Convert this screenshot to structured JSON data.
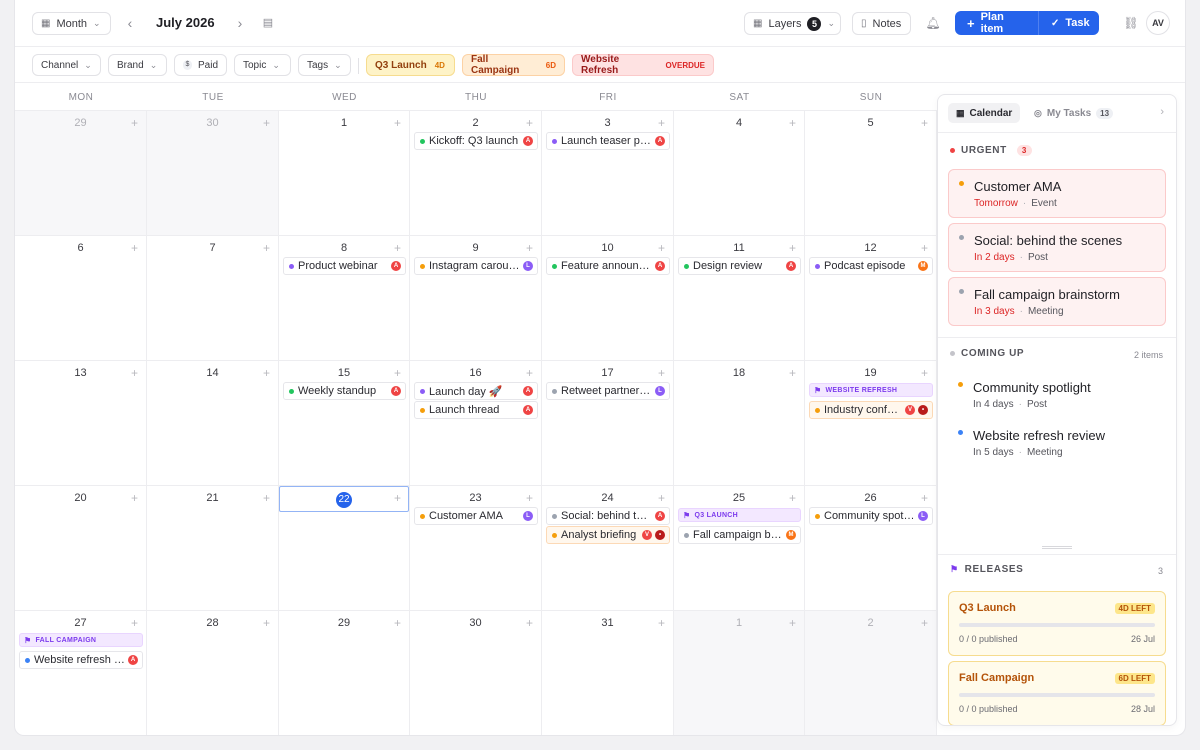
{
  "toolbar": {
    "view_label": "Month",
    "month_title": "July 2026",
    "layers_label": "Layers",
    "layers_count": "5",
    "notes_label": "Notes",
    "plan_item_label": "Plan item",
    "task_label": "Task",
    "avatar_initials": "AV"
  },
  "filters": {
    "channel": "Channel",
    "brand": "Brand",
    "paid": "Paid",
    "paid_symbol": "$",
    "topic": "Topic",
    "tags": "Tags",
    "pills": [
      {
        "label": "Q3 Launch",
        "tag": "4D",
        "bg": "#fef3c7",
        "border": "#f6dc8f",
        "color": "#92400e",
        "tag_color": "#d97706"
      },
      {
        "label": "Fall Campaign",
        "tag": "6D",
        "bg": "#ffedd5",
        "border": "#fcd2a5",
        "color": "#9a3412",
        "tag_color": "#ea580c"
      },
      {
        "label": "Website Refresh",
        "tag": "OVERDUE",
        "bg": "#fee2e2",
        "border": "#fbcaca",
        "color": "#991b1b",
        "tag_color": "#dc2626"
      }
    ]
  },
  "weekdays": [
    "MON",
    "TUE",
    "WED",
    "THU",
    "FRI",
    "SAT",
    "SUN"
  ],
  "weeks": [
    [
      {
        "d": "29",
        "muted": true
      },
      {
        "d": "30",
        "muted": true
      },
      {
        "d": "1"
      },
      {
        "d": "2"
      },
      {
        "d": "3"
      },
      {
        "d": "4"
      },
      {
        "d": "5"
      }
    ],
    [
      {
        "d": "6"
      },
      {
        "d": "7"
      },
      {
        "d": "8"
      },
      {
        "d": "9"
      },
      {
        "d": "10"
      },
      {
        "d": "11"
      },
      {
        "d": "12"
      }
    ],
    [
      {
        "d": "13"
      },
      {
        "d": "14"
      },
      {
        "d": "15"
      },
      {
        "d": "16"
      },
      {
        "d": "17"
      },
      {
        "d": "18"
      },
      {
        "d": "19"
      }
    ],
    [
      {
        "d": "20"
      },
      {
        "d": "21"
      },
      {
        "d": "22",
        "today": true
      },
      {
        "d": "23"
      },
      {
        "d": "24"
      },
      {
        "d": "25"
      },
      {
        "d": "26"
      }
    ],
    [
      {
        "d": "27"
      },
      {
        "d": "28"
      },
      {
        "d": "29"
      },
      {
        "d": "30"
      },
      {
        "d": "31"
      },
      {
        "d": "1",
        "muted": true
      },
      {
        "d": "2",
        "muted": true
      }
    ]
  ],
  "colors": {
    "green": "#22c55e",
    "purple": "#8b5cf6",
    "orange": "#f59e0b",
    "gray": "#9ca3af",
    "blue": "#3b82f6",
    "badge_red": "#ef4444",
    "badge_purple": "#8b5cf6",
    "badge_orange": "#f97316",
    "badge_dark": "#b91c1c"
  },
  "events": [
    {
      "week": 0,
      "day": 3,
      "slot": 0,
      "title": "Kickoff: Q3 launch",
      "dot": "#22c55e",
      "badges": [
        {
          "t": "A",
          "c": "#ef4444"
        }
      ]
    },
    {
      "week": 0,
      "day": 4,
      "slot": 0,
      "title": "Launch teaser post",
      "dot": "#8b5cf6",
      "badges": [
        {
          "t": "A",
          "c": "#ef4444"
        }
      ]
    },
    {
      "week": 1,
      "day": 2,
      "slot": 0,
      "title": "Product webinar",
      "dot": "#8b5cf6",
      "badges": [
        {
          "t": "A",
          "c": "#ef4444"
        }
      ]
    },
    {
      "week": 1,
      "day": 3,
      "slot": 0,
      "title": "Instagram carousel",
      "dot": "#f59e0b",
      "badges": [
        {
          "t": "L",
          "c": "#8b5cf6"
        }
      ]
    },
    {
      "week": 1,
      "day": 4,
      "slot": 0,
      "title": "Feature announcement",
      "dot": "#22c55e",
      "badges": [
        {
          "t": "A",
          "c": "#ef4444"
        }
      ]
    },
    {
      "week": 1,
      "day": 5,
      "slot": 0,
      "title": "Design review",
      "dot": "#22c55e",
      "badges": [
        {
          "t": "A",
          "c": "#ef4444"
        }
      ]
    },
    {
      "week": 1,
      "day": 6,
      "slot": 0,
      "title": "Podcast episode",
      "dot": "#8b5cf6",
      "badges": [
        {
          "t": "M",
          "c": "#f97316"
        }
      ]
    },
    {
      "week": 2,
      "day": 2,
      "slot": 0,
      "title": "Weekly standup",
      "dot": "#22c55e",
      "badges": [
        {
          "t": "A",
          "c": "#ef4444"
        }
      ]
    },
    {
      "week": 2,
      "day": 3,
      "slot": 0,
      "title": "Launch day 🚀",
      "dot": "#8b5cf6",
      "badges": [
        {
          "t": "A",
          "c": "#ef4444"
        }
      ]
    },
    {
      "week": 2,
      "day": 3,
      "slot": 1,
      "title": "Launch thread",
      "dot": "#f59e0b",
      "badges": [
        {
          "t": "A",
          "c": "#ef4444"
        }
      ]
    },
    {
      "week": 2,
      "day": 4,
      "slot": 0,
      "title": "Retweet partner post",
      "dot": "#9ca3af",
      "badges": [
        {
          "t": "L",
          "c": "#8b5cf6"
        }
      ]
    },
    {
      "week": 2,
      "day": 6,
      "slot": 1,
      "title": "Industry conference",
      "dot": "#f59e0b",
      "badges": [
        {
          "t": "V",
          "c": "#ef4444"
        },
        {
          "t": "•",
          "c": "#b91c1c"
        }
      ],
      "warn": true
    },
    {
      "week": 3,
      "day": 3,
      "slot": 0,
      "title": "Customer AMA",
      "dot": "#f59e0b",
      "badges": [
        {
          "t": "L",
          "c": "#8b5cf6"
        }
      ]
    },
    {
      "week": 3,
      "day": 4,
      "slot": 0,
      "title": "Social: behind the scenes",
      "dot": "#9ca3af",
      "badges": [
        {
          "t": "A",
          "c": "#ef4444"
        }
      ]
    },
    {
      "week": 3,
      "day": 4,
      "slot": 1,
      "title": "Analyst briefing",
      "dot": "#f59e0b",
      "badges": [
        {
          "t": "V",
          "c": "#ef4444"
        },
        {
          "t": "•",
          "c": "#b91c1c"
        }
      ],
      "warn": true
    },
    {
      "week": 3,
      "day": 5,
      "slot": 1,
      "title": "Fall campaign brainstorm",
      "dot": "#9ca3af",
      "badges": [
        {
          "t": "M",
          "c": "#f97316"
        }
      ]
    },
    {
      "week": 3,
      "day": 6,
      "slot": 0,
      "title": "Community spotlight",
      "dot": "#f59e0b",
      "badges": [
        {
          "t": "L",
          "c": "#8b5cf6"
        }
      ]
    },
    {
      "week": 4,
      "day": 0,
      "slot": 1,
      "title": "Website refresh review",
      "dot": "#3b82f6",
      "badges": [
        {
          "t": "A",
          "c": "#ef4444"
        }
      ]
    }
  ],
  "banners": [
    {
      "week": 2,
      "day": 6,
      "label": "WEBSITE REFRESH"
    },
    {
      "week": 3,
      "day": 5,
      "label": "Q3 LAUNCH"
    },
    {
      "week": 4,
      "day": 0,
      "label": "FALL CAMPAIGN"
    }
  ],
  "panel": {
    "tab_calendar": "Calendar",
    "tab_tasks": "My Tasks",
    "tasks_count": "13",
    "urgent_label": "URGENT",
    "urgent_count": "3",
    "urgent": [
      {
        "title": "Customer AMA",
        "when": "Tomorrow",
        "type": "Event",
        "dot": "#f59e0b"
      },
      {
        "title": "Social: behind the scenes",
        "when": "In 2 days",
        "type": "Post",
        "dot": "#9ca3af"
      },
      {
        "title": "Fall campaign brainstorm",
        "when": "In 3 days",
        "type": "Meeting",
        "dot": "#9ca3af"
      }
    ],
    "coming_label": "COMING UP",
    "coming_count": "2 items",
    "coming": [
      {
        "title": "Community spotlight",
        "when": "In 4 days",
        "type": "Post",
        "dot": "#f59e0b"
      },
      {
        "title": "Website refresh review",
        "when": "In 5 days",
        "type": "Meeting",
        "dot": "#3b82f6"
      }
    ],
    "releases_label": "RELEASES",
    "releases_count": "3",
    "releases": [
      {
        "name": "Q3 Launch",
        "left": "4D LEFT",
        "progress": "0 / 0 published",
        "progress_fraction": 0,
        "date": "26 Jul"
      },
      {
        "name": "Fall Campaign",
        "left": "6D LEFT",
        "progress": "0 / 0 published",
        "progress_fraction": 0,
        "date": "28 Jul"
      }
    ]
  }
}
